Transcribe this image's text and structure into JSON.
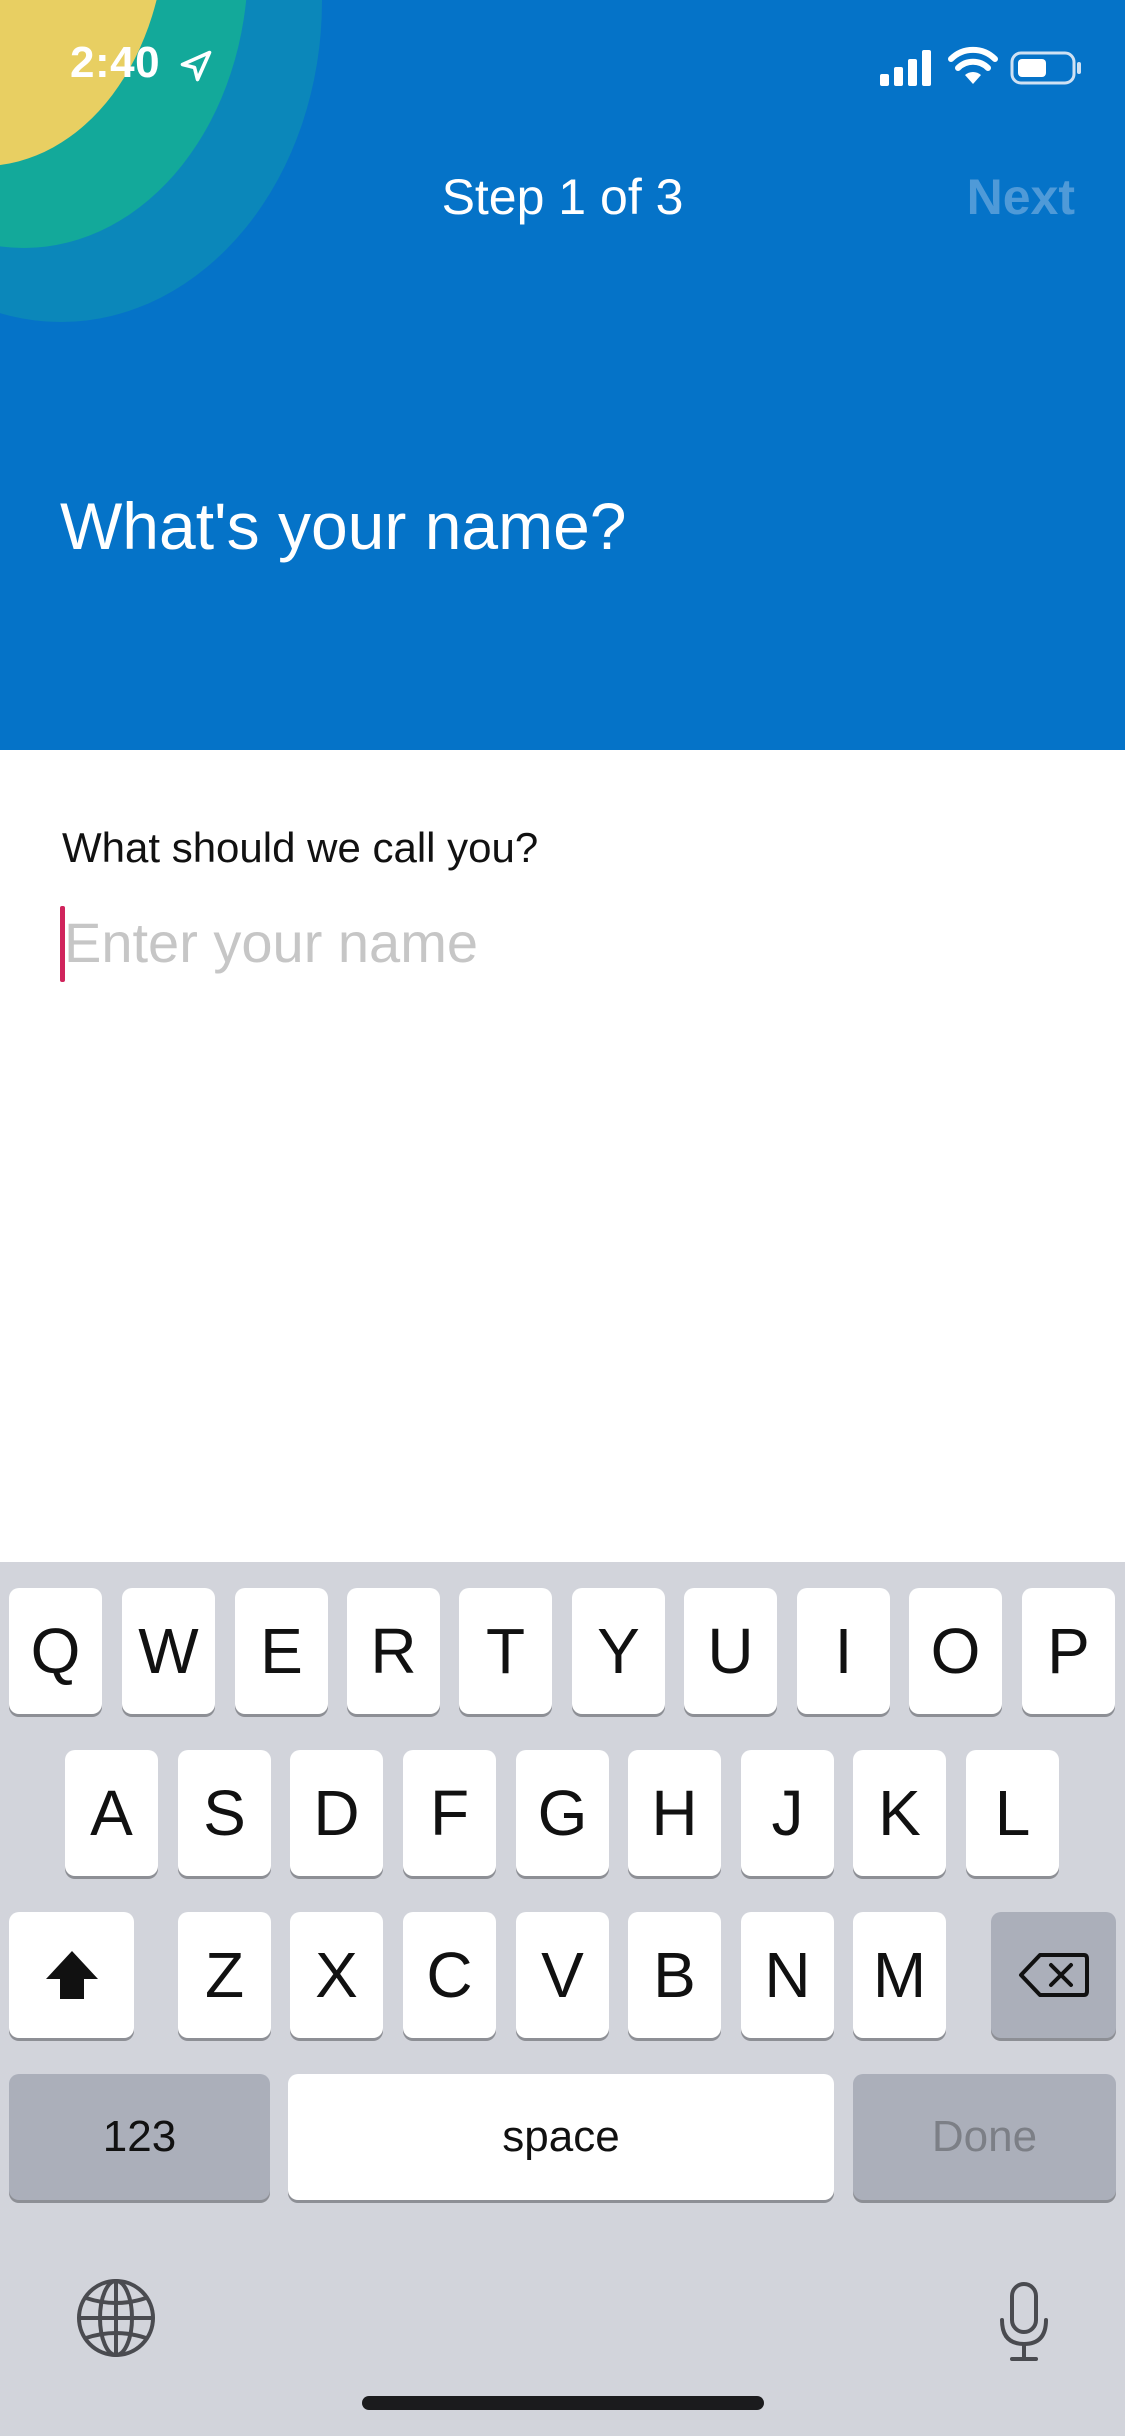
{
  "status_bar": {
    "time": "2:40"
  },
  "header": {
    "step_title": "Step 1 of 3",
    "next_label": "Next",
    "question": "What's your name?",
    "colors": {
      "background": "#0573c8",
      "next_disabled": "#4f9ad8"
    }
  },
  "form": {
    "label": "What should we call you?",
    "name_value": "",
    "name_placeholder": "Enter your name",
    "caret_color": "#d0245c"
  },
  "keyboard": {
    "row1": [
      "Q",
      "W",
      "E",
      "R",
      "T",
      "Y",
      "U",
      "I",
      "O",
      "P"
    ],
    "row2": [
      "A",
      "S",
      "D",
      "F",
      "G",
      "H",
      "J",
      "K",
      "L"
    ],
    "row3": [
      "Z",
      "X",
      "C",
      "V",
      "B",
      "N",
      "M"
    ],
    "numbers_label": "123",
    "space_label": "space",
    "done_label": "Done",
    "icons": [
      "shift-icon",
      "backspace-icon",
      "globe-icon",
      "microphone-icon"
    ]
  }
}
